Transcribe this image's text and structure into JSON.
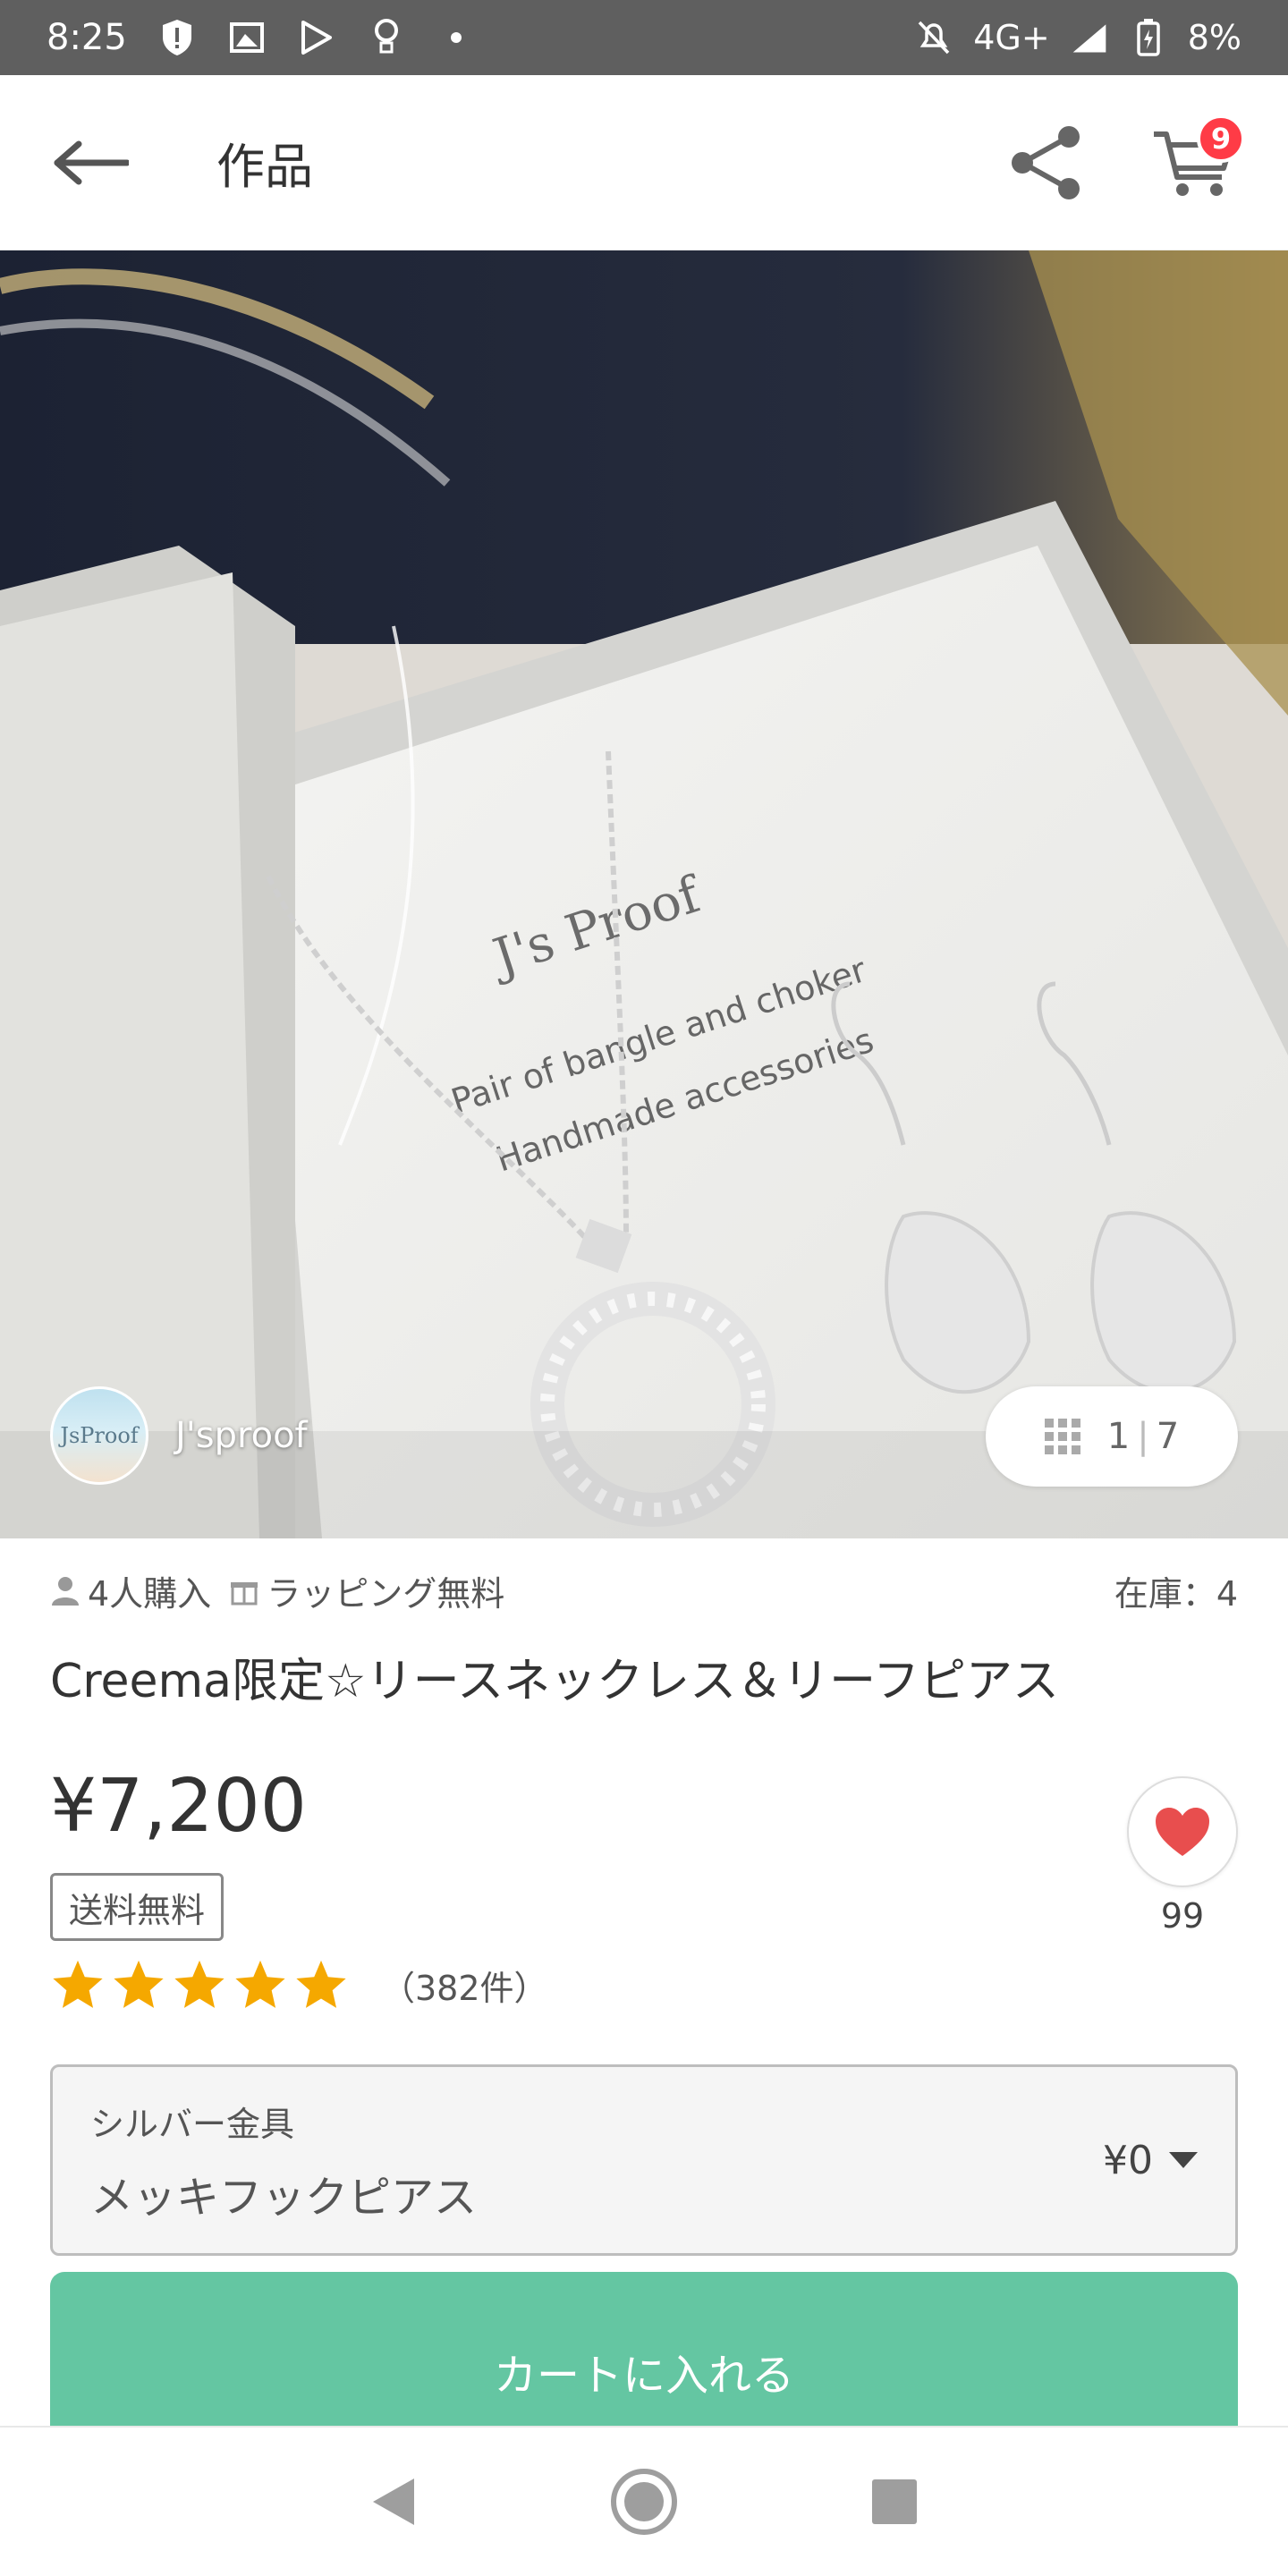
{
  "status_bar": {
    "time": "8:25",
    "network": "4G+",
    "battery": "8%",
    "icons": [
      "shield-alert-icon",
      "photo-icon",
      "play-store-icon",
      "lightbulb-icon",
      "dot-icon",
      "mute-icon",
      "signal-icon",
      "battery-icon"
    ]
  },
  "header": {
    "title": "作品",
    "cart_badge": "9",
    "icons": [
      "back-arrow-icon",
      "share-icon",
      "cart-icon"
    ]
  },
  "gallery": {
    "shop_name": "J'sproof",
    "avatar_text": "JsProof",
    "current": "1",
    "total": "7",
    "photo_text": {
      "brand": "J's Proof",
      "line1": "Pair of bangle and choker",
      "line2": "Handmade accessories"
    }
  },
  "meta": {
    "purchases": "4人購入",
    "wrapping": "ラッピング無料",
    "stock": "在庫：4"
  },
  "product": {
    "title": "Creema限定☆リースネックレス＆リーフピアス",
    "price": "¥7,200",
    "shipping_badge": "送料無料",
    "rating_stars": 5,
    "review_count": "（382件）",
    "favorite_count": "99"
  },
  "variant": {
    "group": "シルバー金具",
    "value": "メッキフックピアス",
    "price": "¥0"
  },
  "actions": {
    "add_to_cart": "カートに入れる"
  },
  "colors": {
    "accent_green": "#64c6a2",
    "star": "#f5a800",
    "heart": "#e84e4e",
    "badge_red": "#ff3b46"
  }
}
